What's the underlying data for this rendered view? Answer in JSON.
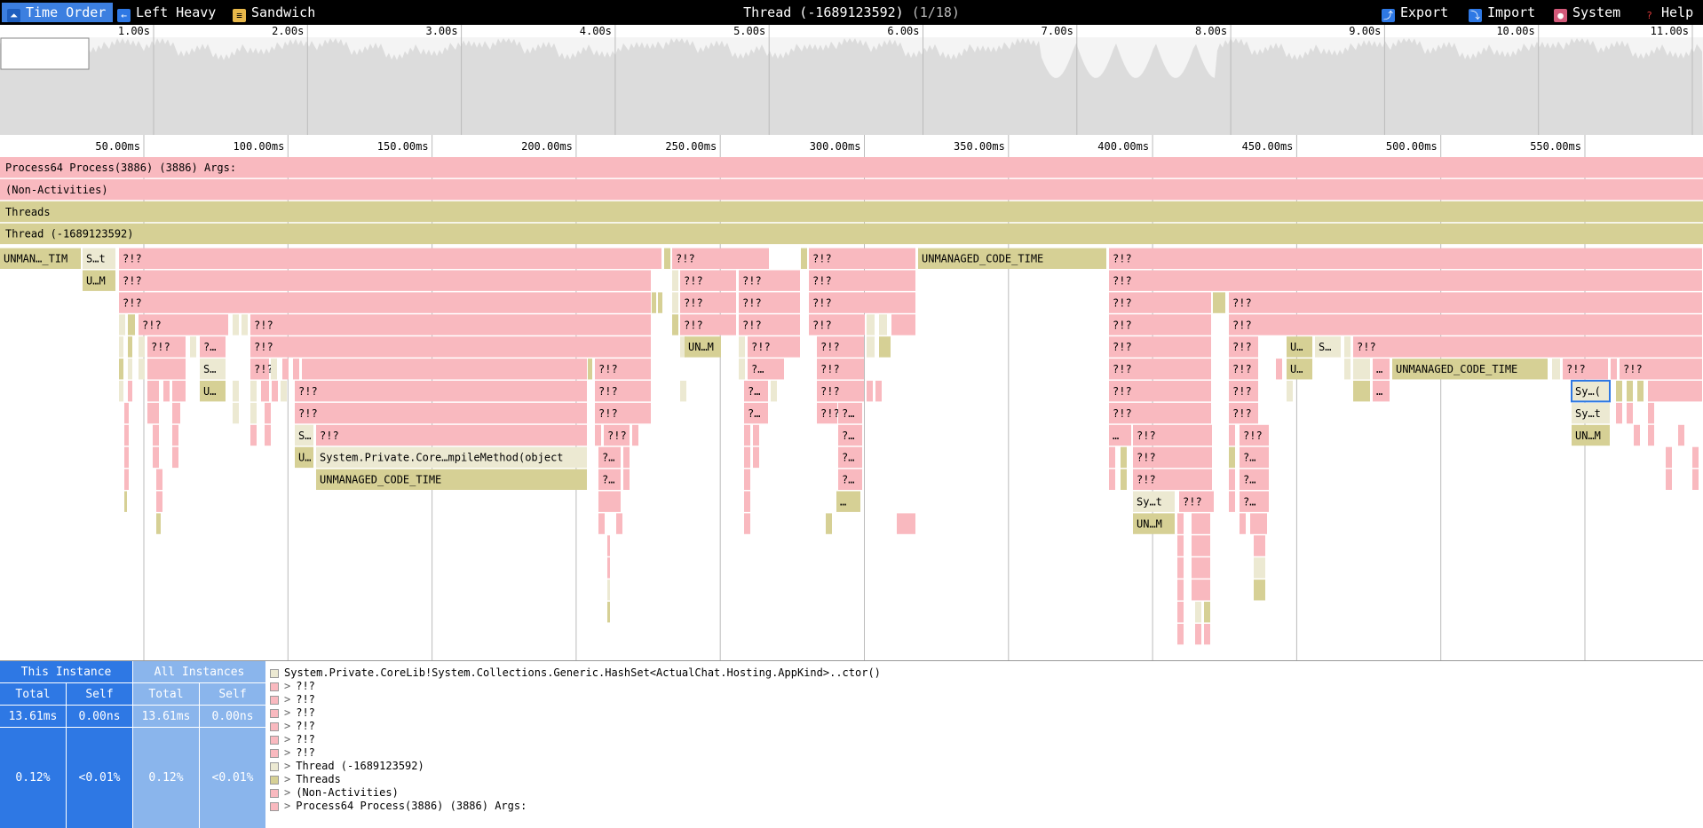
{
  "toolbar": {
    "time_order": "Time Order",
    "left_heavy": "Left Heavy",
    "sandwich": "Sandwich",
    "export": "Export",
    "import": "Import",
    "system": "System",
    "help": "Help"
  },
  "title": {
    "thread": "Thread (-1689123592)",
    "index": "(1/18)"
  },
  "overview_ticks": [
    "1.00s",
    "2.00s",
    "3.00s",
    "4.00s",
    "5.00s",
    "6.00s",
    "7.00s",
    "8.00s",
    "9.00s",
    "10.00s",
    "11.00s"
  ],
  "flame_ticks": [
    "50.00ms",
    "100.00ms",
    "150.00ms",
    "200.00ms",
    "250.00ms",
    "300.00ms",
    "350.00ms",
    "400.00ms",
    "450.00ms",
    "500.00ms",
    "550.00ms"
  ],
  "colors": {
    "pink": "#f9b9bf",
    "olive": "#d6d095",
    "cream": "#ece9d2",
    "accent": "#2e78e4"
  },
  "flame_rows": [
    "Process64 Process(3886) (3886) Args:",
    "(Non-Activities)",
    "Threads",
    "Thread (-1689123592)"
  ],
  "labels": {
    "unman_tim": "UNMAN…_TIM",
    "s_t": "S…t",
    "u_m": "U…M",
    "qq": "?!?",
    "q_short": "?…",
    "s_short": "S…",
    "u_short": "U…",
    "un_m": "UN…M",
    "unmanaged": "UNMANAGED_CODE_TIME",
    "compile_method": "System.Private.Core…mpileMethod(object",
    "sy_t": "Sy…t",
    "sy_paren": "Sy…(",
    "dots": "…",
    "dots_short": "…"
  },
  "bottom": {
    "this_instance": "This Instance",
    "all_instances": "All Instances",
    "total": "Total",
    "self": "Self",
    "this_total": "13.61ms",
    "this_self": "0.00ns",
    "all_total": "13.61ms",
    "all_self": "0.00ns",
    "this_total_pct": "0.12%",
    "this_self_pct": "<0.01%",
    "all_total_pct": "0.12%",
    "all_self_pct": "<0.01%",
    "selected_frame": "System.Private.CoreLib!System.Collections.Generic.HashSet<ActualChat.Hosting.AppKind>..ctor()",
    "stack": [
      {
        "label": "?!?",
        "color": "pink"
      },
      {
        "label": "?!?",
        "color": "pink"
      },
      {
        "label": "?!?",
        "color": "pink"
      },
      {
        "label": "?!?",
        "color": "pink"
      },
      {
        "label": "?!?",
        "color": "pink"
      },
      {
        "label": "?!?",
        "color": "pink"
      },
      {
        "label": "Thread (-1689123592)",
        "color": "cream"
      },
      {
        "label": "Threads",
        "color": "olive"
      },
      {
        "label": "(Non-Activities)",
        "color": "pink"
      },
      {
        "label": "Process64 Process(3886) (3886) Args:",
        "color": "pink"
      }
    ]
  }
}
